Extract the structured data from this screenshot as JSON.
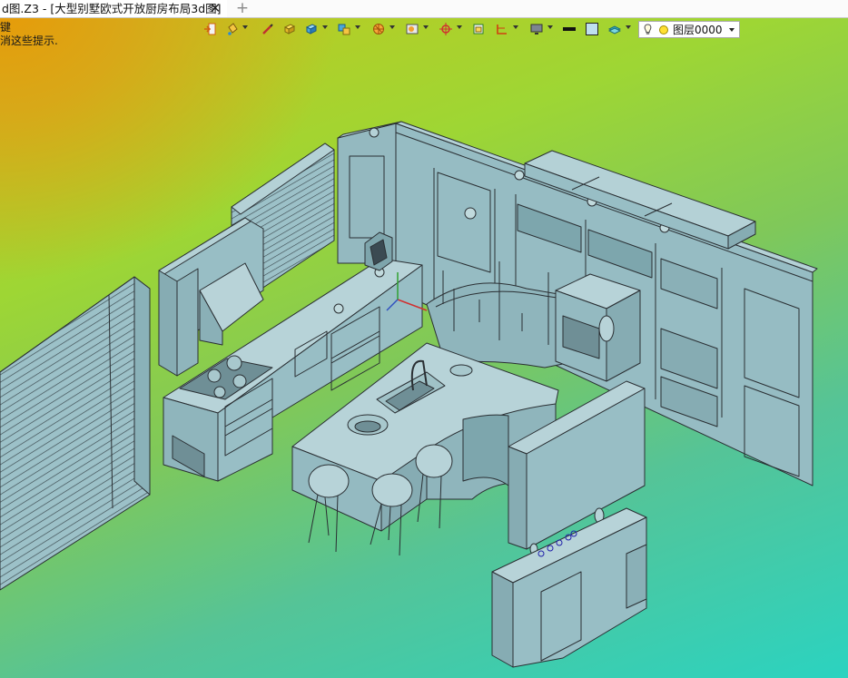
{
  "tab": {
    "title": "d图.Z3 - [大型别墅欧式开放厨房布局3d图]",
    "close_glyph": "✕",
    "add_glyph": "+"
  },
  "hint": {
    "line1": "键",
    "line2": "消这些提示."
  },
  "layer": {
    "name": "图层0000"
  },
  "toolbar_icons": [
    "import-icon",
    "paint-bucket-icon",
    "pen-icon",
    "solid-box-icon",
    "cube-view-icon",
    "multi-view-icon",
    "render-mode-icon",
    "image-icon",
    "snap-target-icon",
    "dimension-icon",
    "display-icon",
    "line-color-swatch",
    "face-color-swatch",
    "layers-stack-icon",
    "lightbulb-icon",
    "layer-color-icon"
  ],
  "colors": {
    "model_face": "#9cc1c8",
    "model_edge": "#2a2f33",
    "accent_orange": "#e89a08",
    "accent_green": "#8fd43a",
    "accent_cyan": "#2bd3c0"
  }
}
